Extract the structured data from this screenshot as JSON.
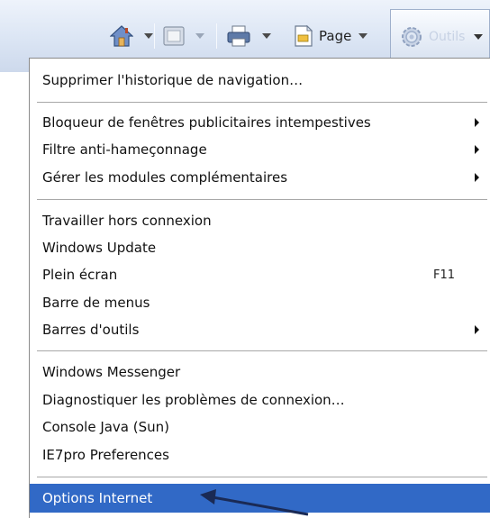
{
  "toolbar": {
    "page_label": "Page",
    "tools_label": "Outils"
  },
  "icons": {
    "home": "home-icon",
    "feeds": "feeds-icon",
    "print": "print-icon",
    "page": "page-icon",
    "tools": "gear-icon",
    "dropdown": "chevron-down-icon",
    "submenu": "submenu-arrow-icon"
  },
  "menu": {
    "items": [
      {
        "label": "Supprimer l'historique de navigation…"
      },
      {
        "label": "Bloqueur de fenêtres publicitaires intempestives"
      },
      {
        "label": "Filtre anti-hameçonnage"
      },
      {
        "label": "Gérer les modules complémentaires"
      },
      {
        "label": "Travailler hors connexion"
      },
      {
        "label": "Windows Update"
      },
      {
        "label": "Plein écran",
        "shortcut": "F11"
      },
      {
        "label": "Barre de menus"
      },
      {
        "label": "Barres d'outils"
      },
      {
        "label": "Windows Messenger"
      },
      {
        "label": "Diagnostiquer les problèmes de connexion…"
      },
      {
        "label": "Console Java (Sun)"
      },
      {
        "label": "IE7pro Preferences"
      },
      {
        "label": "Options Internet"
      }
    ]
  },
  "colors": {
    "selection": "#3169c6",
    "toolbar": "#dbe5f4",
    "annotation_arrow": "#1a2a55"
  }
}
